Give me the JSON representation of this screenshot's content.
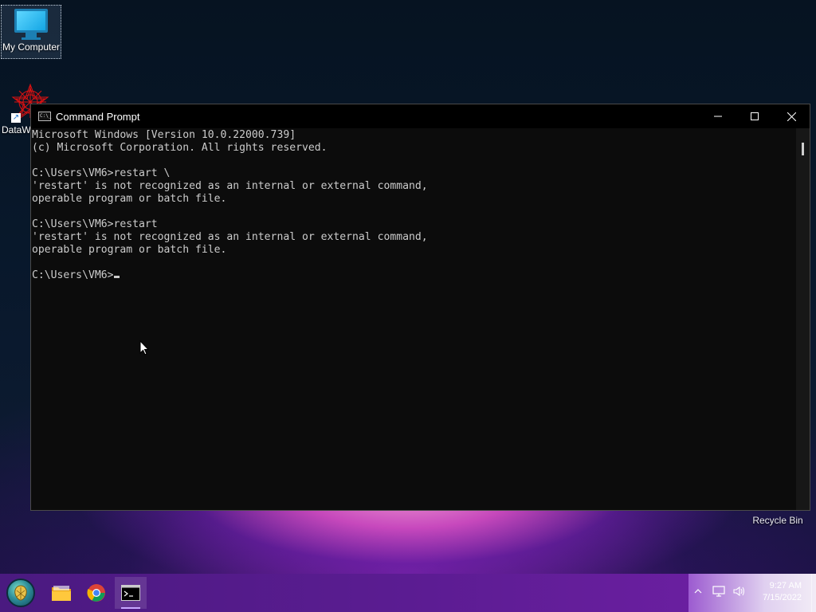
{
  "desktop": {
    "icons": [
      {
        "label": "My Computer"
      },
      {
        "label": "DataW"
      },
      {
        "label": "Recycle Bin"
      }
    ]
  },
  "window": {
    "title": "Command Prompt",
    "console_text": "Microsoft Windows [Version 10.0.22000.739]\n(c) Microsoft Corporation. All rights reserved.\n\nC:\\Users\\VM6>restart \\\n'restart' is not recognized as an internal or external command,\noperable program or batch file.\n\nC:\\Users\\VM6>restart\n'restart' is not recognized as an internal or external command,\noperable program or batch file.\n\nC:\\Users\\VM6>"
  },
  "taskbar": {
    "apps": [
      {
        "icon": "start-orb-icon"
      },
      {
        "icon": "file-explorer-icon"
      },
      {
        "icon": "chrome-icon"
      },
      {
        "icon": "command-prompt-icon"
      }
    ],
    "clock": {
      "time": "9:27 AM",
      "date": "7/15/2022"
    }
  },
  "colors": {
    "console_bg": "#0c0c0c",
    "console_text": "#cccccc",
    "taskbar": "#5b1c92"
  }
}
